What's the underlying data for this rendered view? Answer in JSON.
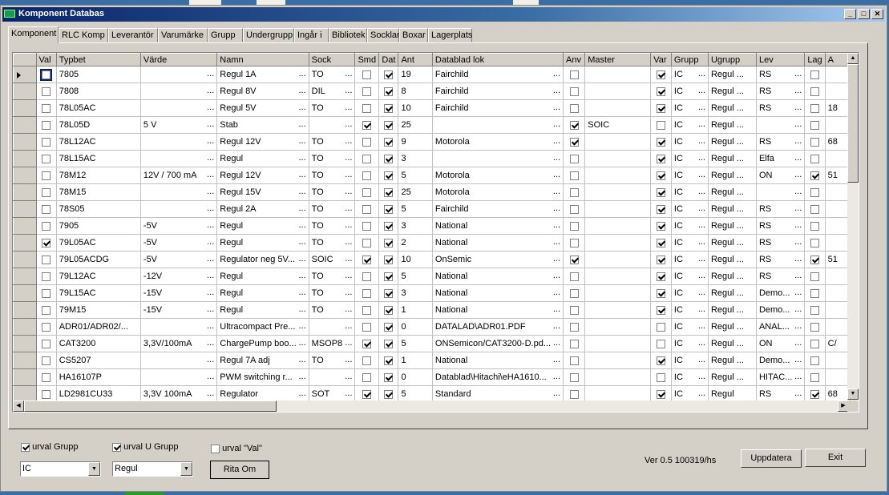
{
  "window": {
    "title": "Komponent Databas"
  },
  "tabs": [
    "Komponent",
    "RLC Komp",
    "Leverantör",
    "Varumärke",
    "Grupp",
    "Undergrupp",
    "Ingår i",
    "Bibliotek",
    "Socklar",
    "Boxar",
    "Lagerplats"
  ],
  "columns": [
    "Val",
    "Typbet",
    "Värde",
    "Namn",
    "Sock",
    "Smd",
    "Dat",
    "Ant",
    "Datablad lok",
    "Anv",
    "Master",
    "Var",
    "Grupp",
    "Ugrupp",
    "Lev",
    "Lag",
    "A"
  ],
  "rows": [
    {
      "val": false,
      "typbet": "7805",
      "varde": "",
      "namn": "Regul  1A",
      "sock": "TO",
      "smd": false,
      "dat": true,
      "ant": "19",
      "datablad": "Fairchild",
      "anv": false,
      "master": "",
      "var": true,
      "grupp": "IC",
      "ugrupp": "Regul ...",
      "lev": "RS",
      "lag": false,
      "a": ""
    },
    {
      "val": false,
      "typbet": "7808",
      "varde": "",
      "namn": "Regul 8V",
      "sock": "DIL",
      "smd": false,
      "dat": true,
      "ant": "8",
      "datablad": "Fairchild",
      "anv": false,
      "master": "",
      "var": true,
      "grupp": "IC",
      "ugrupp": "Regul ...",
      "lev": "RS",
      "lag": false,
      "a": ""
    },
    {
      "val": false,
      "typbet": "78L05AC",
      "varde": "",
      "namn": "Regul  5V",
      "sock": "TO",
      "smd": false,
      "dat": true,
      "ant": "10",
      "datablad": "Fairchild",
      "anv": false,
      "master": "",
      "var": true,
      "grupp": "IC",
      "ugrupp": "Regul ...",
      "lev": "RS",
      "lag": false,
      "a": "18"
    },
    {
      "val": false,
      "typbet": "78L05D",
      "varde": "5 V",
      "namn": "Stab",
      "sock": "",
      "smd": true,
      "dat": true,
      "ant": "25",
      "datablad": "",
      "anv": true,
      "master": "SOIC",
      "var": false,
      "grupp": "IC",
      "ugrupp": "Regul ...",
      "lev": "",
      "lag": false,
      "a": ""
    },
    {
      "val": false,
      "typbet": "78L12AC",
      "varde": "",
      "namn": "Regul  12V",
      "sock": "TO",
      "smd": false,
      "dat": true,
      "ant": "9",
      "datablad": "Motorola",
      "anv": true,
      "master": "",
      "var": true,
      "grupp": "IC",
      "ugrupp": "Regul ...",
      "lev": "RS",
      "lag": false,
      "a": "68"
    },
    {
      "val": false,
      "typbet": "78L15AC",
      "varde": "",
      "namn": "Regul",
      "sock": "TO",
      "smd": false,
      "dat": true,
      "ant": "3",
      "datablad": "",
      "anv": false,
      "master": "",
      "var": true,
      "grupp": "IC",
      "ugrupp": "Regul ...",
      "lev": "Elfa",
      "lag": false,
      "a": ""
    },
    {
      "val": false,
      "typbet": "78M12",
      "varde": "12V / 700 mA",
      "namn": "Regul  12V",
      "sock": "TO",
      "smd": false,
      "dat": true,
      "ant": "5",
      "datablad": "Motorola",
      "anv": false,
      "master": "",
      "var": true,
      "grupp": "IC",
      "ugrupp": "Regul ...",
      "lev": "ON",
      "lag": true,
      "a": "51"
    },
    {
      "val": false,
      "typbet": "78M15",
      "varde": "",
      "namn": "Regul  15V",
      "sock": "TO",
      "smd": false,
      "dat": true,
      "ant": "25",
      "datablad": "Motorola",
      "anv": false,
      "master": "",
      "var": true,
      "grupp": "IC",
      "ugrupp": "Regul ...",
      "lev": "",
      "lag": false,
      "a": ""
    },
    {
      "val": false,
      "typbet": "78S05",
      "varde": "",
      "namn": "Regul  2A",
      "sock": "TO",
      "smd": false,
      "dat": true,
      "ant": "5",
      "datablad": "Fairchild",
      "anv": false,
      "master": "",
      "var": true,
      "grupp": "IC",
      "ugrupp": "Regul ...",
      "lev": "RS",
      "lag": false,
      "a": ""
    },
    {
      "val": false,
      "typbet": "7905",
      "varde": "-5V",
      "namn": "Regul",
      "sock": "TO",
      "smd": false,
      "dat": true,
      "ant": "3",
      "datablad": "National",
      "anv": false,
      "master": "",
      "var": true,
      "grupp": "IC",
      "ugrupp": "Regul ...",
      "lev": "RS",
      "lag": false,
      "a": ""
    },
    {
      "val": true,
      "typbet": "79L05AC",
      "varde": "-5V",
      "namn": "Regul",
      "sock": "TO",
      "smd": false,
      "dat": true,
      "ant": "2",
      "datablad": "National",
      "anv": false,
      "master": "",
      "var": true,
      "grupp": "IC",
      "ugrupp": "Regul ...",
      "lev": "RS",
      "lag": false,
      "a": ""
    },
    {
      "val": false,
      "typbet": "79L05ACDG",
      "varde": "-5V",
      "namn": "Regulator neg 5V...",
      "sock": "SOIC",
      "smd": true,
      "dat": true,
      "ant": "10",
      "datablad": "OnSemic",
      "anv": true,
      "master": "",
      "var": true,
      "grupp": "IC",
      "ugrupp": "Regul ...",
      "lev": "RS",
      "lag": true,
      "a": "51"
    },
    {
      "val": false,
      "typbet": "79L12AC",
      "varde": "-12V",
      "namn": "Regul",
      "sock": "TO",
      "smd": false,
      "dat": true,
      "ant": "5",
      "datablad": "National",
      "anv": false,
      "master": "",
      "var": true,
      "grupp": "IC",
      "ugrupp": "Regul ...",
      "lev": "RS",
      "lag": false,
      "a": ""
    },
    {
      "val": false,
      "typbet": "79L15AC",
      "varde": "-15V",
      "namn": "Regul",
      "sock": "TO",
      "smd": false,
      "dat": true,
      "ant": "3",
      "datablad": "National",
      "anv": false,
      "master": "",
      "var": true,
      "grupp": "IC",
      "ugrupp": "Regul ...",
      "lev": "Demo...",
      "lag": false,
      "a": ""
    },
    {
      "val": false,
      "typbet": "79M15",
      "varde": "-15V",
      "namn": "Regul",
      "sock": "TO",
      "smd": false,
      "dat": true,
      "ant": "1",
      "datablad": "National",
      "anv": false,
      "master": "",
      "var": true,
      "grupp": "IC",
      "ugrupp": "Regul ...",
      "lev": "Demo...",
      "lag": false,
      "a": ""
    },
    {
      "val": false,
      "typbet": "ADR01/ADR02/...",
      "varde": "",
      "namn": "Ultracompact Pre...",
      "sock": "",
      "smd": false,
      "dat": true,
      "ant": "0",
      "datablad": "DATALAD\\ADR01.PDF",
      "anv": false,
      "master": "",
      "var": false,
      "grupp": "IC",
      "ugrupp": "Regul ...",
      "lev": "ANAL...",
      "lag": false,
      "a": ""
    },
    {
      "val": false,
      "typbet": "CAT3200",
      "varde": "3,3V/100mA",
      "namn": "ChargePump boo...",
      "sock": "MSOP8",
      "smd": true,
      "dat": true,
      "ant": "5",
      "datablad": "ONSemicon/CAT3200-D.pd...",
      "anv": false,
      "master": "",
      "var": false,
      "grupp": "IC",
      "ugrupp": "Regul ...",
      "lev": "ON",
      "lag": false,
      "a": "C/"
    },
    {
      "val": false,
      "typbet": "CS5207",
      "varde": "",
      "namn": "Regul  7A adj",
      "sock": "TO",
      "smd": false,
      "dat": true,
      "ant": "1",
      "datablad": "National",
      "anv": false,
      "master": "",
      "var": true,
      "grupp": "IC",
      "ugrupp": "Regul ...",
      "lev": "Demo...",
      "lag": false,
      "a": ""
    },
    {
      "val": false,
      "typbet": "HA16107P",
      "varde": "",
      "namn": "PWM switching r...",
      "sock": "",
      "smd": false,
      "dat": true,
      "ant": "0",
      "datablad": "Datablad\\Hitachi\\eHA1610...",
      "anv": false,
      "master": "",
      "var": false,
      "grupp": "IC",
      "ugrupp": "Regul ...",
      "lev": "HITAC...",
      "lag": false,
      "a": ""
    },
    {
      "val": false,
      "typbet": "LD2981CU33",
      "varde": "3,3V 100mA",
      "namn": "Regulator",
      "sock": "SOT",
      "smd": true,
      "dat": true,
      "ant": "5",
      "datablad": "Standard",
      "anv": false,
      "master": "",
      "var": true,
      "grupp": "IC",
      "ugrupp": "Regul",
      "lev": "RS",
      "lag": true,
      "a": "68"
    }
  ],
  "filters": {
    "urval_grupp": {
      "label": "urval Grupp",
      "checked": true
    },
    "urval_ugrupp": {
      "label": "urval U Grupp",
      "checked": true
    },
    "urval_val": {
      "label": "urval \"Val\"",
      "checked": false
    },
    "grupp_value": "IC",
    "ugrupp_value": "Regul",
    "rita_om": "Rita Om"
  },
  "version": "Ver 0.5  100319/hs",
  "buttons": {
    "uppdatera": "Uppdatera",
    "exit": "Exit"
  }
}
